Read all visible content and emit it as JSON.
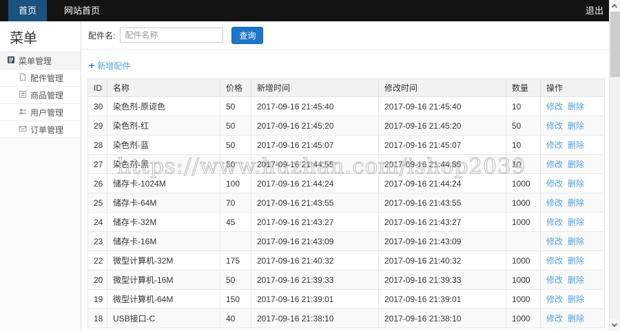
{
  "topbar": {
    "tabs": [
      {
        "label": "首页",
        "active": true
      },
      {
        "label": "网站首页",
        "active": false
      }
    ],
    "logout_label": "退出"
  },
  "sidebar": {
    "title": "菜单",
    "items": [
      {
        "icon": "menu-icon",
        "label": "菜单管理"
      },
      {
        "icon": "file-icon",
        "label": "配件管理"
      },
      {
        "icon": "product-icon",
        "label": "商品管理"
      },
      {
        "icon": "user-icon",
        "label": "用户管理"
      },
      {
        "icon": "order-icon",
        "label": "订单管理"
      }
    ]
  },
  "search": {
    "label": "配件名:",
    "placeholder": "配件名称",
    "button_label": "查询"
  },
  "toolbar": {
    "plus_icon": "+",
    "add_label": "新增配件"
  },
  "table": {
    "headers": [
      "ID",
      "名称",
      "价格",
      "新增时间",
      "修改时间",
      "数量",
      "操作"
    ],
    "action_labels": {
      "edit": "修改",
      "delete": "删除"
    },
    "rows": [
      {
        "id": "30",
        "name": "染色剂-原谅色",
        "price": "50",
        "created": "2017-09-16 21:45:40",
        "modified": "2017-09-16 21:45:40",
        "qty": "10"
      },
      {
        "id": "29",
        "name": "染色剂-红",
        "price": "50",
        "created": "2017-09-16 21:45:20",
        "modified": "2017-09-16 21:45:20",
        "qty": "50"
      },
      {
        "id": "28",
        "name": "染色剂-蓝",
        "price": "50",
        "created": "2017-09-16 21:45:07",
        "modified": "2017-09-16 21:45:07",
        "qty": "10"
      },
      {
        "id": "27",
        "name": "染色剂-黑",
        "price": "50",
        "created": "2017-09-16 21:44:55",
        "modified": "2017-09-16 21:44:55",
        "qty": "10"
      },
      {
        "id": "26",
        "name": "储存卡-1024M",
        "price": "100",
        "created": "2017-09-16 21:44:24",
        "modified": "2017-09-16 21:44:24",
        "qty": "1000"
      },
      {
        "id": "25",
        "name": "储存卡-64M",
        "price": "70",
        "created": "2017-09-16 21:43:55",
        "modified": "2017-09-16 21:43:55",
        "qty": "1000"
      },
      {
        "id": "24",
        "name": "储存卡-32M",
        "price": "45",
        "created": "2017-09-16 21:43:27",
        "modified": "2017-09-16 21:43:27",
        "qty": "1000"
      },
      {
        "id": "23",
        "name": "储存卡-16M",
        "price": "",
        "created": "2017-09-16 21:43:09",
        "modified": "2017-09-16 21:43:09",
        "qty": ""
      },
      {
        "id": "22",
        "name": "微型计算机-32M",
        "price": "175",
        "created": "2017-09-16 21:40:32",
        "modified": "2017-09-16 21:40:32",
        "qty": "1000"
      },
      {
        "id": "20",
        "name": "微型计算机-16M",
        "price": "50",
        "created": "2017-09-16 21:39:33",
        "modified": "2017-09-16 21:39:33",
        "qty": "1000"
      },
      {
        "id": "19",
        "name": "微型计算机-64M",
        "price": "150",
        "created": "2017-09-16 21:39:01",
        "modified": "2017-09-16 21:39:01",
        "qty": "1000"
      },
      {
        "id": "18",
        "name": "USB接口-C",
        "price": "40",
        "created": "2017-09-16 21:38:10",
        "modified": "2017-09-16 21:38:10",
        "qty": "1000"
      }
    ]
  },
  "watermark": "https://www.huzhan.com/ishop2039",
  "colors": {
    "topbar_bg": "#141414",
    "tab_active": "#1a527e",
    "accent_button": "#1d76c8",
    "link": "#52a3dc"
  }
}
